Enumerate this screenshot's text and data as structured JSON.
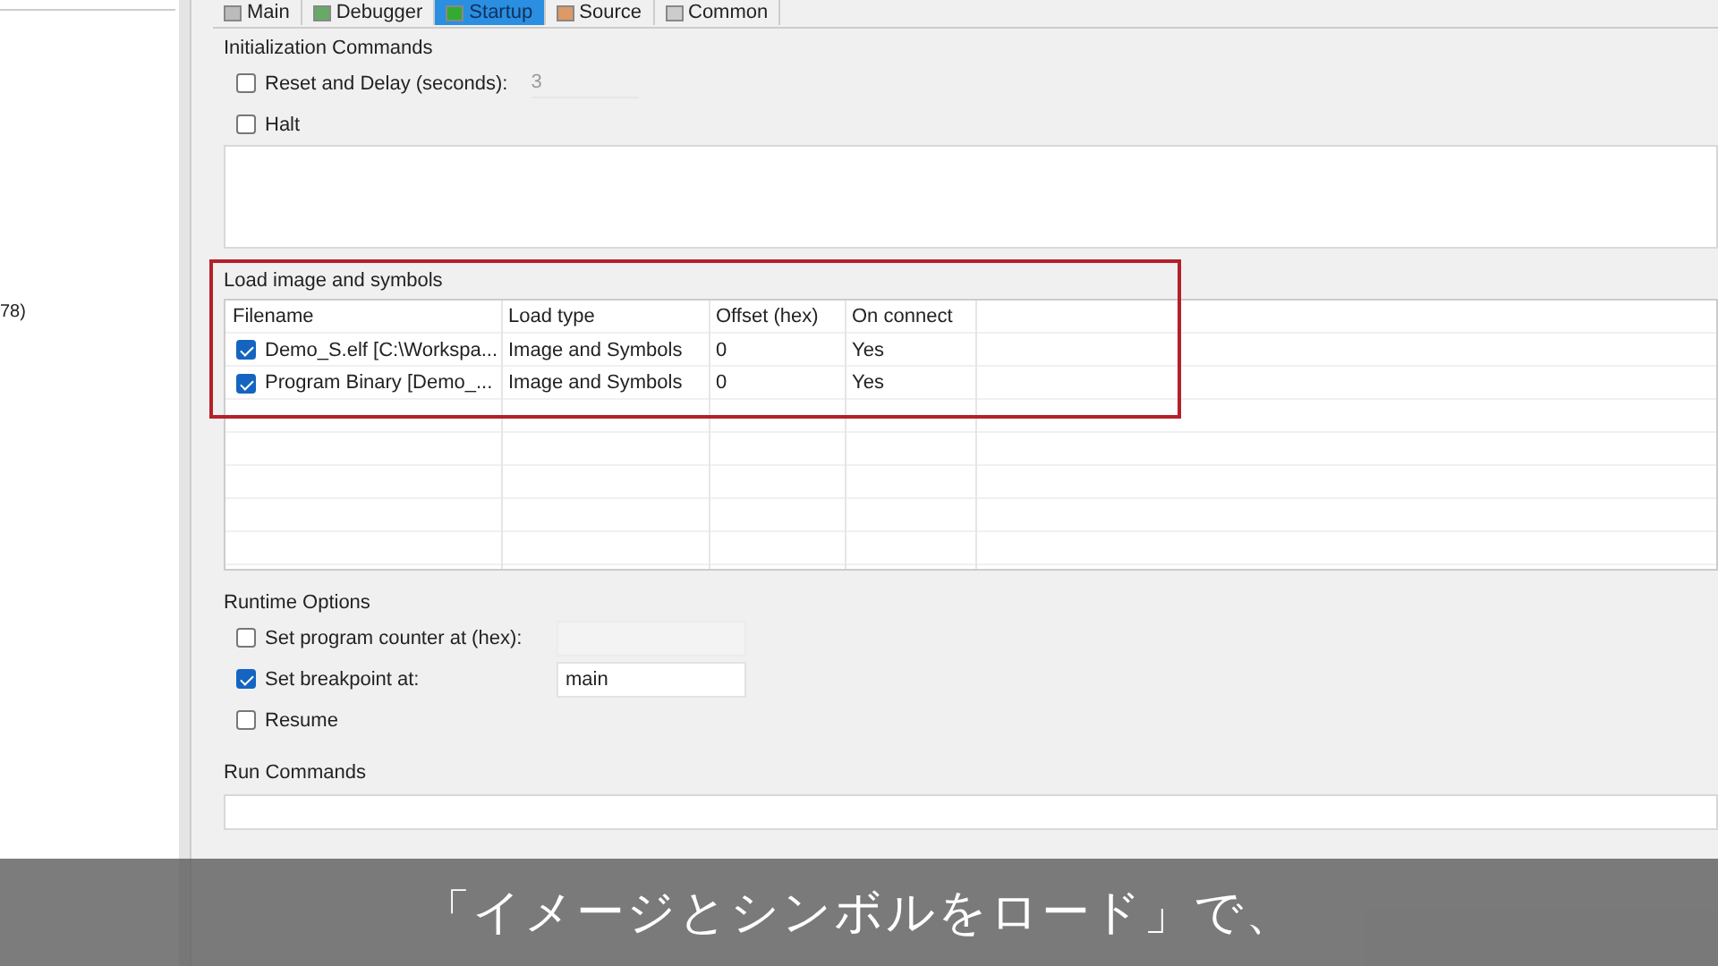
{
  "left_panel": {
    "fragment": "78)"
  },
  "tabs": [
    {
      "label": "Main",
      "selected": false
    },
    {
      "label": "Debugger",
      "selected": false
    },
    {
      "label": "Startup",
      "selected": true
    },
    {
      "label": "Source",
      "selected": false
    },
    {
      "label": "Common",
      "selected": false
    }
  ],
  "initialization_commands": {
    "title": "Initialization Commands",
    "options": [
      {
        "label": "Reset and Delay (seconds):",
        "checked": false,
        "value": "3"
      },
      {
        "label": "Halt",
        "checked": false
      }
    ]
  },
  "load_image_and_symbols": {
    "title": "Load image and symbols",
    "highlighted": true,
    "columns": [
      "Filename",
      "Load type",
      "Offset (hex)",
      "On connect"
    ],
    "rows": [
      {
        "checked": true,
        "cells": [
          "Demo_S.elf [C:\\Workspa...",
          "Image and Symbols",
          "0",
          "Yes"
        ]
      },
      {
        "checked": true,
        "cells": [
          "Program Binary [Demo_...",
          "Image and Symbols",
          "0",
          "Yes"
        ]
      }
    ]
  },
  "runtime_options": {
    "title": "Runtime Options",
    "options": [
      {
        "label": "Set program counter at (hex):",
        "checked": false,
        "kind": "field"
      },
      {
        "label": "Set breakpoint at:",
        "checked": true,
        "kind": "field",
        "value": "main"
      },
      {
        "label": "Resume",
        "checked": false,
        "kind": "plain"
      }
    ]
  },
  "run_commands": {
    "title": "Run Commands"
  },
  "caption": "「イメージとシンボルをロード」で、"
}
